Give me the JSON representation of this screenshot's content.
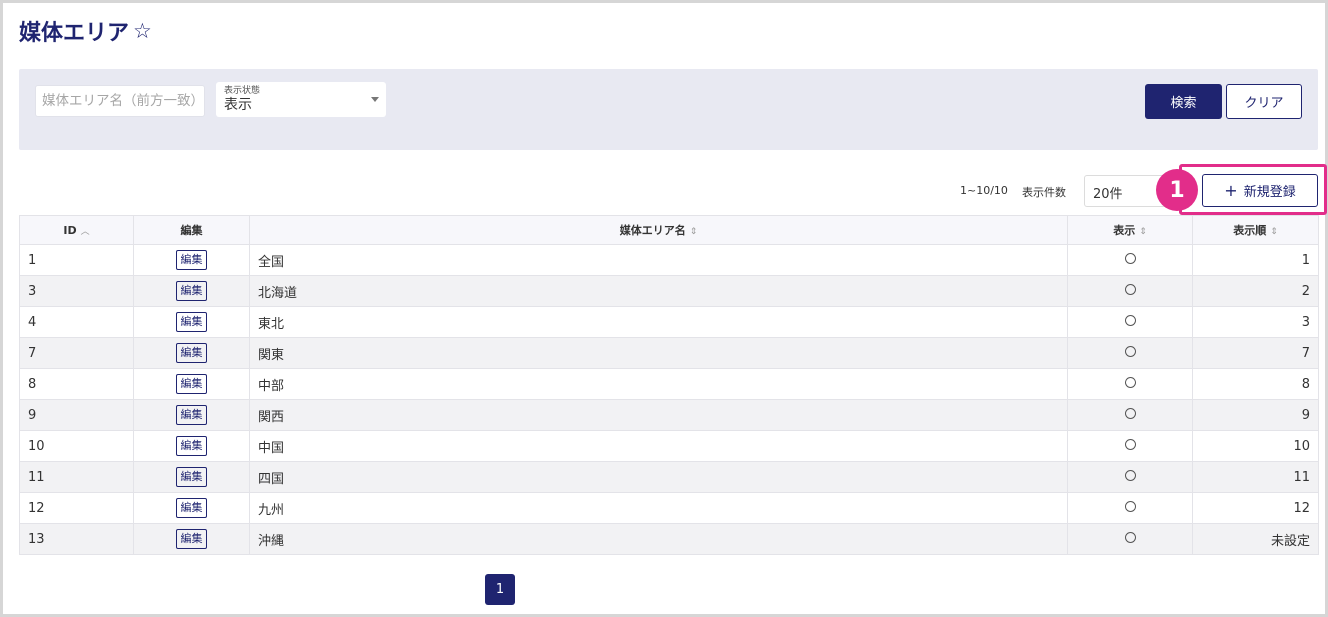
{
  "page": {
    "title": "媒体エリア",
    "star": "☆"
  },
  "filter": {
    "name_placeholder": "媒体エリア名（前方一致）",
    "status_label": "表示状態",
    "status_value": "表示",
    "search_label": "検索",
    "clear_label": "クリア"
  },
  "toolbar": {
    "range": "1~10/10",
    "per_page_label": "表示件数",
    "per_page_value": "20件",
    "new_label": "新規登録",
    "step_number": "1"
  },
  "table": {
    "headers": {
      "id": "ID",
      "edit": "編集",
      "name": "媒体エリア名",
      "visible": "表示",
      "order": "表示順"
    },
    "edit_label": "編集",
    "rows": [
      {
        "id": "1",
        "name": "全国",
        "order": "1"
      },
      {
        "id": "3",
        "name": "北海道",
        "order": "2"
      },
      {
        "id": "4",
        "name": "東北",
        "order": "3"
      },
      {
        "id": "7",
        "name": "関東",
        "order": "7"
      },
      {
        "id": "8",
        "name": "中部",
        "order": "8"
      },
      {
        "id": "9",
        "name": "関西",
        "order": "9"
      },
      {
        "id": "10",
        "name": "中国",
        "order": "10"
      },
      {
        "id": "11",
        "name": "四国",
        "order": "11"
      },
      {
        "id": "12",
        "name": "九州",
        "order": "12"
      },
      {
        "id": "13",
        "name": "沖縄",
        "order": "未設定"
      }
    ]
  },
  "pagination": {
    "current": "1"
  },
  "colors": {
    "primary": "#1f2470",
    "highlight": "#e22d8a"
  }
}
